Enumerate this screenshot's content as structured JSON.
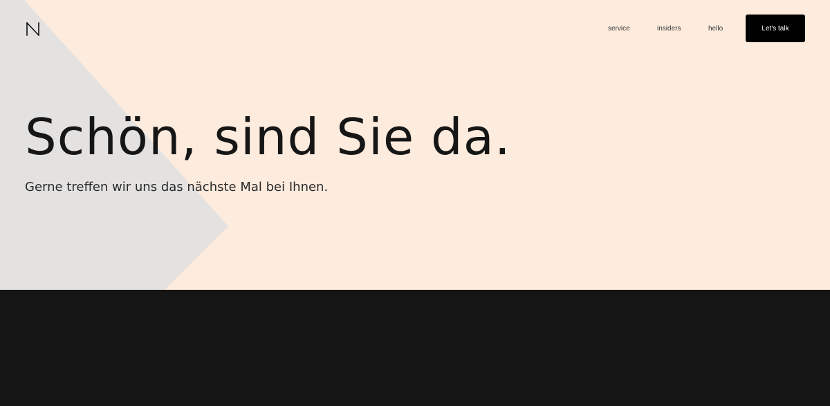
{
  "colors": {
    "hero_bg": "#fdebdd",
    "shape": "#e3e2e1",
    "dark_section": "#151515",
    "cta_bg": "#000000",
    "text": "#161616"
  },
  "logo": {
    "icon": "n-logo-icon"
  },
  "nav": {
    "items": [
      {
        "label": "service"
      },
      {
        "label": "insiders"
      },
      {
        "label": "hello"
      }
    ],
    "cta_label": "Let's talk"
  },
  "hero": {
    "headline": "Schön, sind Sie da.",
    "subline": "Gerne treffen wir uns das nächste Mal bei Ihnen."
  }
}
